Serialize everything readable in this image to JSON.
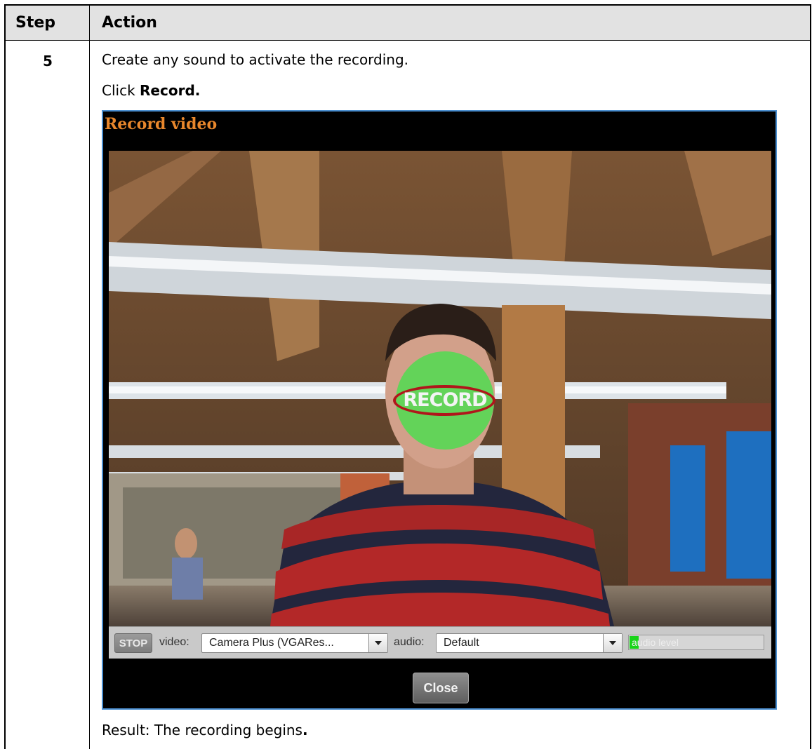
{
  "table": {
    "header": {
      "step": "Step",
      "action": "Action"
    },
    "row": {
      "step_number": "5",
      "instruction_1": "Create any sound to activate the recording.",
      "instruction_2_prefix": "Click ",
      "instruction_2_bold": "Record.",
      "result_prefix": "Result: The recording begins",
      "result_bold": "."
    }
  },
  "recorder": {
    "title": "Record video",
    "record_button_label": "RECORD",
    "stop_label": "STOP",
    "video_label": "video:",
    "video_device": "Camera Plus (VGARes...",
    "audio_label": "audio:",
    "audio_device": "Default",
    "audio_level_label": "audio level",
    "audio_level_fraction": 0.07,
    "close_label": "Close"
  },
  "colors": {
    "title_orange": "#e8872c",
    "record_green": "#50dc50",
    "record_ring_red": "#b0161b",
    "frame_blue": "#4a8fd1",
    "header_gray": "#e2e2e2"
  }
}
